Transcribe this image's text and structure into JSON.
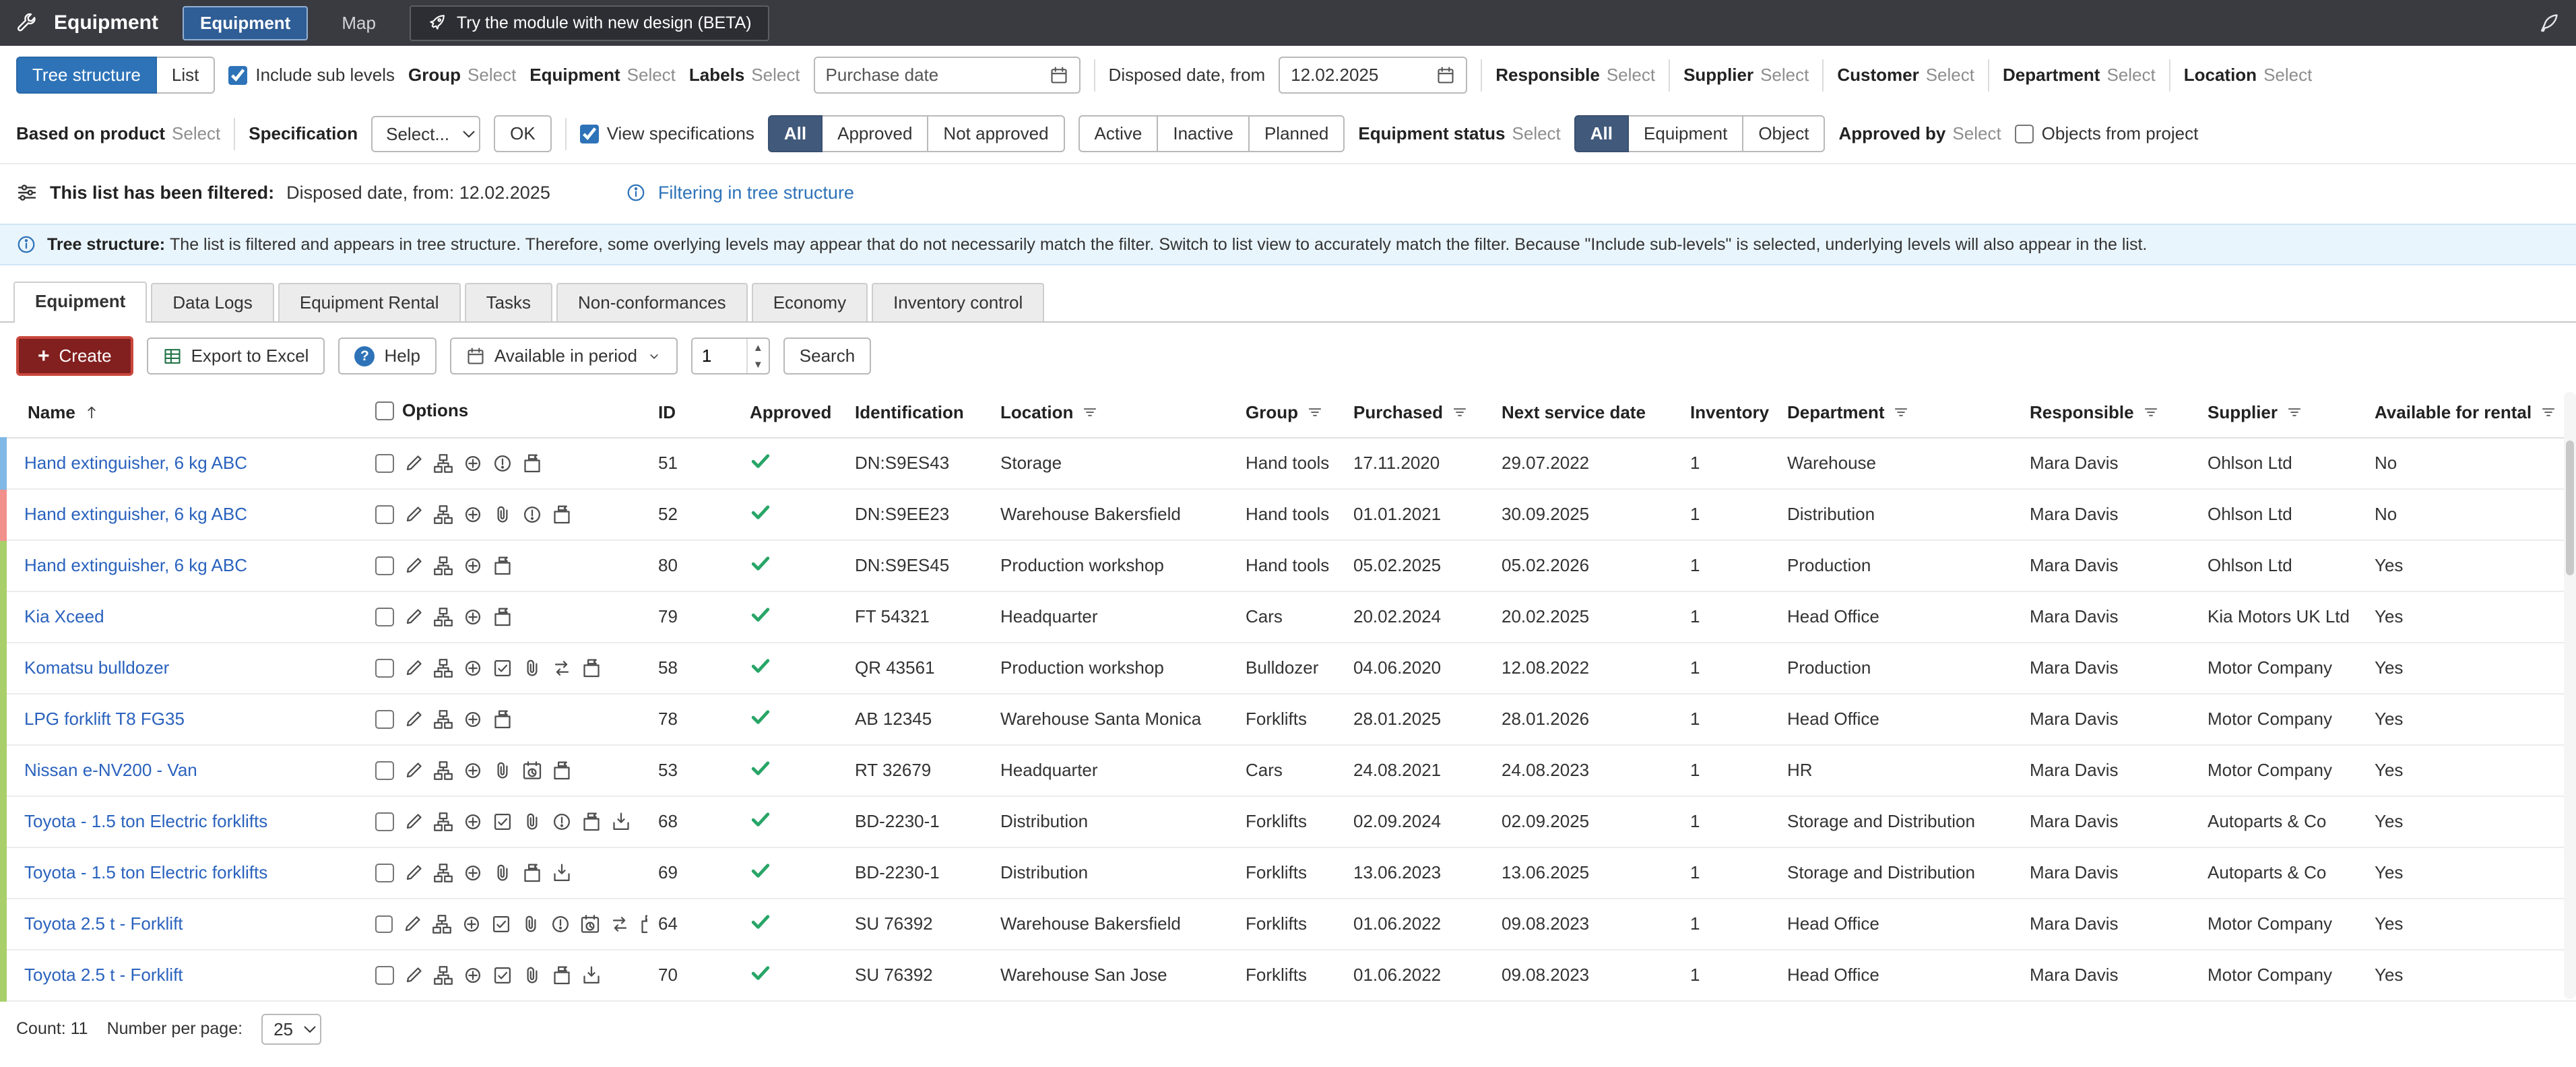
{
  "topbar": {
    "title": "Equipment",
    "nav": [
      {
        "label": "Equipment",
        "active": true
      },
      {
        "label": "Map",
        "active": false
      }
    ],
    "beta_label": "Try the module with new design (BETA)"
  },
  "filter_row1": {
    "view_buttons": [
      {
        "label": "Tree structure",
        "active": true
      },
      {
        "label": "List",
        "active": false
      }
    ],
    "include_sub_levels": "Include sub levels",
    "selects": [
      {
        "label": "Group",
        "value": "Select"
      },
      {
        "label": "Equipment",
        "value": "Select"
      },
      {
        "label": "Labels",
        "value": "Select"
      }
    ],
    "purchase_date": {
      "placeholder": "Purchase date"
    },
    "disposed_date": {
      "label": "Disposed date, from",
      "value": "12.02.2025"
    },
    "selects_right": [
      {
        "label": "Responsible",
        "value": "Select"
      },
      {
        "label": "Supplier",
        "value": "Select"
      },
      {
        "label": "Customer",
        "value": "Select"
      },
      {
        "label": "Department",
        "value": "Select"
      },
      {
        "label": "Location",
        "value": "Select"
      }
    ]
  },
  "filter_row2": {
    "based_on_product": {
      "label": "Based on product",
      "value": "Select"
    },
    "specification": {
      "label": "Specification",
      "dropdown": "Select...",
      "ok": "OK"
    },
    "view_specifications": "View specifications",
    "approval_buttons": [
      {
        "label": "All",
        "active": true
      },
      {
        "label": "Approved",
        "active": false
      },
      {
        "label": "Not approved",
        "active": false
      }
    ],
    "state_buttons": [
      {
        "label": "Active",
        "active": false
      },
      {
        "label": "Inactive",
        "active": false
      },
      {
        "label": "Planned",
        "active": false
      }
    ],
    "equipment_status": {
      "label": "Equipment status",
      "value": "Select"
    },
    "type_buttons": [
      {
        "label": "All",
        "active": true
      },
      {
        "label": "Equipment",
        "active": false
      },
      {
        "label": "Object",
        "active": false
      }
    ],
    "approved_by": {
      "label": "Approved by",
      "value": "Select"
    },
    "objects_from_project": "Objects from project"
  },
  "filter_status": {
    "label": "This list has been filtered:",
    "value": "Disposed date, from: 12.02.2025",
    "link": "Filtering in tree structure"
  },
  "banner": {
    "title": "Tree structure:",
    "text": "The list is filtered and appears in tree structure. Therefore, some overlying levels may appear that do not necessarily match the filter. Switch to list view to accurately match the filter. Because \"Include sub-levels\" is selected, underlying levels will also appear in the list."
  },
  "tabs": [
    {
      "label": "Equipment",
      "active": true
    },
    {
      "label": "Data Logs",
      "active": false
    },
    {
      "label": "Equipment Rental",
      "active": false
    },
    {
      "label": "Tasks",
      "active": false
    },
    {
      "label": "Non-conformances",
      "active": false
    },
    {
      "label": "Economy",
      "active": false
    },
    {
      "label": "Inventory control",
      "active": false
    }
  ],
  "toolbar": {
    "create": "Create",
    "export": "Export to Excel",
    "help": "Help",
    "period": "Available in period",
    "period_value": "1",
    "search": "Search"
  },
  "colors": {
    "accent_blue": "#2e73b8",
    "selected_dark": "#41597a",
    "create_red": "#82201f",
    "approved_green": "#27a567",
    "banner_blue": "#e9f5fc"
  },
  "stripe_colors": {
    "blue": "#7fb8e6",
    "red": "#f2908c",
    "green": "#a8cf6a"
  },
  "table": {
    "columns": [
      {
        "label": "Name",
        "sort": "asc"
      },
      {
        "label": "Options",
        "checkbox": true
      },
      {
        "label": "ID"
      },
      {
        "label": "Approved"
      },
      {
        "label": "Identification"
      },
      {
        "label": "Location",
        "filter": true
      },
      {
        "label": "Group",
        "filter": true
      },
      {
        "label": "Purchased",
        "filter": true
      },
      {
        "label": "Next service date"
      },
      {
        "label": "Inventory"
      },
      {
        "label": "Department",
        "filter": true
      },
      {
        "label": "Responsible",
        "filter": true
      },
      {
        "label": "Supplier",
        "filter": true
      },
      {
        "label": "Available for rental",
        "filter": true
      }
    ],
    "rows": [
      {
        "stripe": "blue",
        "name": "Hand extinguisher, 6 kg ABC",
        "icons": [
          "edit",
          "hierarchy",
          "crosshair",
          "alert",
          "flag-box"
        ],
        "id": "51",
        "approved": true,
        "identification": "DN:S9ES43",
        "location": "Storage",
        "group": "Hand tools",
        "purchased": "17.11.2020",
        "next_service": "29.07.2022",
        "inventory": "1",
        "department": "Warehouse",
        "responsible": "Mara Davis",
        "supplier": "Ohlson Ltd",
        "rental": "No"
      },
      {
        "stripe": "red",
        "name": "Hand extinguisher, 6 kg ABC",
        "icons": [
          "edit",
          "hierarchy",
          "crosshair",
          "paperclip",
          "alert",
          "flag-box"
        ],
        "id": "52",
        "approved": true,
        "identification": "DN:S9EE23",
        "location": "Warehouse Bakersfield",
        "group": "Hand tools",
        "purchased": "01.01.2021",
        "next_service": "30.09.2025",
        "inventory": "1",
        "department": "Distribution",
        "responsible": "Mara Davis",
        "supplier": "Ohlson Ltd",
        "rental": "No"
      },
      {
        "stripe": "green",
        "name": "Hand extinguisher, 6 kg ABC",
        "icons": [
          "edit",
          "hierarchy",
          "crosshair",
          "flag-box"
        ],
        "id": "80",
        "approved": true,
        "identification": "DN:S9ES45",
        "location": "Production workshop",
        "group": "Hand tools",
        "purchased": "05.02.2025",
        "next_service": "05.02.2026",
        "inventory": "1",
        "department": "Production",
        "responsible": "Mara Davis",
        "supplier": "Ohlson Ltd",
        "rental": "Yes"
      },
      {
        "stripe": "green",
        "name": "Kia Xceed",
        "icons": [
          "edit",
          "hierarchy",
          "crosshair",
          "flag-box"
        ],
        "id": "79",
        "approved": true,
        "identification": "FT 54321",
        "location": "Headquarter",
        "group": "Cars",
        "purchased": "20.02.2024",
        "next_service": "20.02.2025",
        "inventory": "1",
        "department": "Head Office",
        "responsible": "Mara Davis",
        "supplier": "Kia Motors UK Ltd",
        "rental": "Yes"
      },
      {
        "stripe": "green",
        "name": "Komatsu bulldozer",
        "icons": [
          "edit",
          "hierarchy",
          "crosshair",
          "checklist",
          "paperclip",
          "swap",
          "flag-box"
        ],
        "id": "58",
        "approved": true,
        "identification": "QR 43561",
        "location": "Production workshop",
        "group": "Bulldozer",
        "purchased": "04.06.2020",
        "next_service": "12.08.2022",
        "inventory": "1",
        "department": "Production",
        "responsible": "Mara Davis",
        "supplier": "Motor Company",
        "rental": "Yes"
      },
      {
        "stripe": "green",
        "name": "LPG forklift T8 FG35",
        "icons": [
          "edit",
          "hierarchy",
          "crosshair",
          "flag-box"
        ],
        "id": "78",
        "approved": true,
        "identification": "AB 12345",
        "location": "Warehouse Santa Monica",
        "group": "Forklifts",
        "purchased": "28.01.2025",
        "next_service": "28.01.2026",
        "inventory": "1",
        "department": "Head Office",
        "responsible": "Mara Davis",
        "supplier": "Motor Company",
        "rental": "Yes"
      },
      {
        "stripe": "green",
        "name": "Nissan e-NV200 - Van",
        "icons": [
          "edit",
          "hierarchy",
          "crosshair",
          "paperclip",
          "calendar-clock",
          "flag-box"
        ],
        "id": "53",
        "approved": true,
        "identification": "RT 32679",
        "location": "Headquarter",
        "group": "Cars",
        "purchased": "24.08.2021",
        "next_service": "24.08.2023",
        "inventory": "1",
        "department": "HR",
        "responsible": "Mara Davis",
        "supplier": "Motor Company",
        "rental": "Yes"
      },
      {
        "stripe": "green",
        "name": "Toyota - 1.5 ton Electric forklifts",
        "icons": [
          "edit",
          "hierarchy",
          "crosshair",
          "checklist",
          "paperclip",
          "alert",
          "flag-box",
          "download-box"
        ],
        "id": "68",
        "approved": true,
        "identification": "BD-2230-1",
        "location": "Distribution",
        "group": "Forklifts",
        "purchased": "02.09.2024",
        "next_service": "02.09.2025",
        "inventory": "1",
        "department": "Storage and Distribution",
        "responsible": "Mara Davis",
        "supplier": "Autoparts & Co",
        "rental": "Yes"
      },
      {
        "stripe": "green",
        "name": "Toyota - 1.5 ton Electric forklifts",
        "icons": [
          "edit",
          "hierarchy",
          "crosshair",
          "paperclip",
          "flag-box",
          "download-box"
        ],
        "id": "69",
        "approved": true,
        "identification": "BD-2230-1",
        "location": "Distribution",
        "group": "Forklifts",
        "purchased": "13.06.2023",
        "next_service": "13.06.2025",
        "inventory": "1",
        "department": "Storage and Distribution",
        "responsible": "Mara Davis",
        "supplier": "Autoparts & Co",
        "rental": "Yes"
      },
      {
        "stripe": "green",
        "name": "Toyota 2.5 t - Forklift",
        "icons": [
          "edit",
          "hierarchy",
          "crosshair",
          "checklist",
          "paperclip",
          "alert",
          "calendar-clock",
          "swap",
          "flag-box",
          "download-box"
        ],
        "id": "64",
        "approved": true,
        "identification": "SU 76392",
        "location": "Warehouse Bakersfield",
        "group": "Forklifts",
        "purchased": "01.06.2022",
        "next_service": "09.08.2023",
        "inventory": "1",
        "department": "Head Office",
        "responsible": "Mara Davis",
        "supplier": "Motor Company",
        "rental": "Yes"
      },
      {
        "stripe": "green",
        "name": "Toyota 2.5 t - Forklift",
        "icons": [
          "edit",
          "hierarchy",
          "crosshair",
          "checklist",
          "paperclip",
          "flag-box",
          "download-box"
        ],
        "id": "70",
        "approved": true,
        "identification": "SU 76392",
        "location": "Warehouse San Jose",
        "group": "Forklifts",
        "purchased": "01.06.2022",
        "next_service": "09.08.2023",
        "inventory": "1",
        "department": "Head Office",
        "responsible": "Mara Davis",
        "supplier": "Motor Company",
        "rental": "Yes"
      }
    ]
  },
  "footer": {
    "count": "Count: 11",
    "per_page_label": "Number per page:",
    "per_page": "25"
  }
}
